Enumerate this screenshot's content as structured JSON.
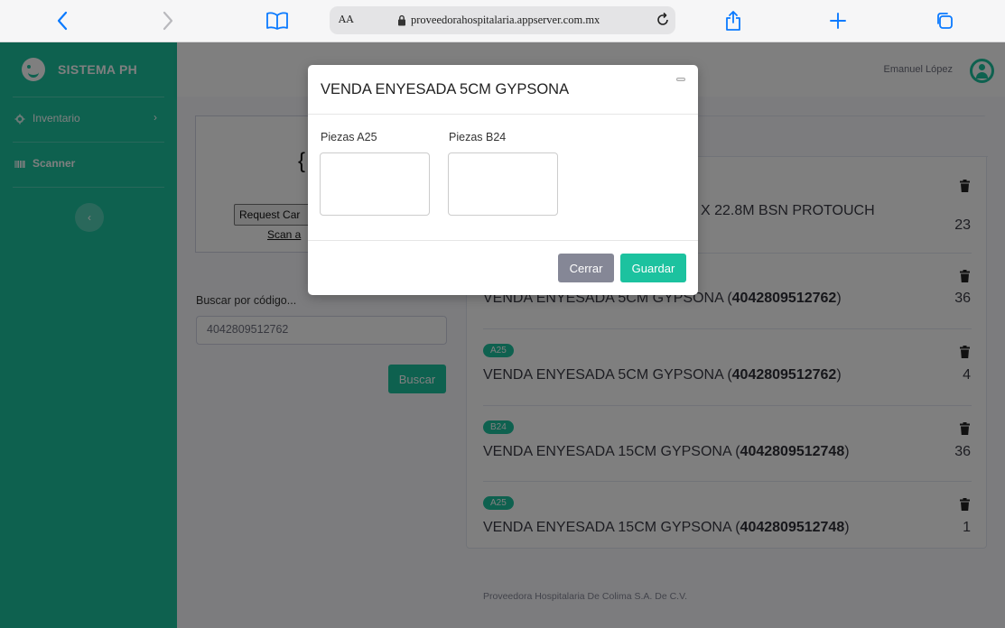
{
  "browser": {
    "text_size_label": "AA",
    "url": "proveedorahospitalaria.appserver.com.mx",
    "icons": [
      "back-icon",
      "forward-icon",
      "bookmarks-icon",
      "lock-icon",
      "reload-icon",
      "share-icon",
      "new-tab-icon",
      "tabs-icon"
    ]
  },
  "sidebar": {
    "brand": "SISTEMA PH",
    "items": [
      {
        "label": "Inventario",
        "icon": "gear-icon",
        "chevron": "›"
      },
      {
        "label": "Scanner",
        "icon": "barcode-icon"
      }
    ],
    "collapse_glyph": "‹"
  },
  "topbar": {
    "user_name": "Emanuel López"
  },
  "scanner": {
    "big_char": "{",
    "request_button": "Request Car",
    "scan_link": "Scan a"
  },
  "search": {
    "label": "Buscar por código...",
    "value": "4042809512762",
    "button": "Buscar"
  },
  "list": {
    "rows": [
      {
        "badge": "",
        "desc_text": "X 22.8M BSN PROTOUCH",
        "code": "",
        "qty": "23"
      },
      {
        "badge": "",
        "desc_text": "VENDA ENYESADA 5CM GYPSONA (",
        "code": "4042809512762",
        "desc_end": ")",
        "qty": "36"
      },
      {
        "badge": "A25",
        "desc_text": "VENDA ENYESADA 5CM GYPSONA (",
        "code": "4042809512762",
        "desc_end": ")",
        "qty": "4"
      },
      {
        "badge": "B24",
        "desc_text": "VENDA ENYESADA 15CM GYPSONA (",
        "code": "4042809512748",
        "desc_end": ")",
        "qty": "36"
      },
      {
        "badge": "A25",
        "desc_text": "VENDA ENYESADA 15CM GYPSONA (",
        "code": "4042809512748",
        "desc_end": ")",
        "qty": "1"
      }
    ]
  },
  "footer": "Proveedora Hospitalaria De Colima S.A. De C.V.",
  "modal": {
    "title": "VENDA ENYESADA 5CM GYPSONA",
    "field_a_label": "Piezas A25",
    "field_b_label": "Piezas B24",
    "field_a_value": "",
    "field_b_value": "",
    "close_button": "Cerrar",
    "save_button": "Guardar"
  },
  "colors": {
    "accent": "#1cc29f",
    "secondary": "#858796"
  }
}
